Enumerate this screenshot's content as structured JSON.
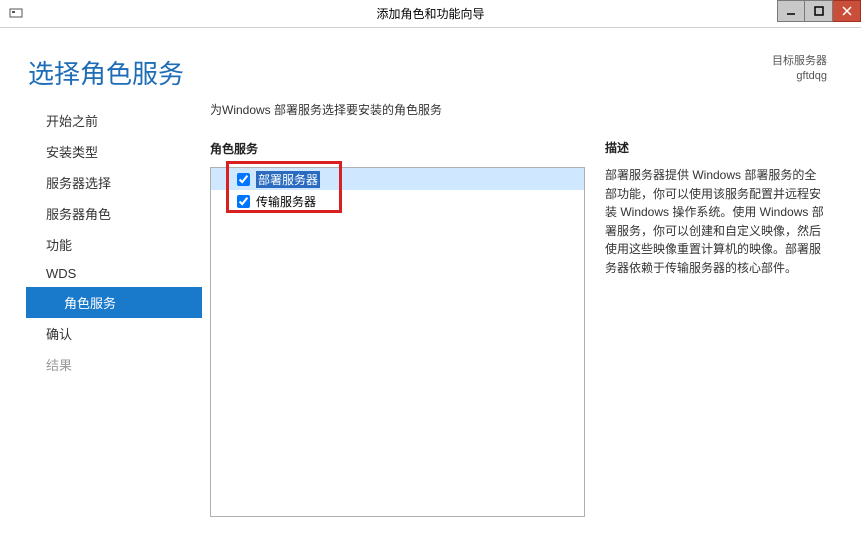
{
  "window": {
    "title": "添加角色和功能向导"
  },
  "header": {
    "page_title": "选择角色服务",
    "target_label": "目标服务器",
    "target_value": "gftdqg"
  },
  "sidebar": {
    "items": [
      {
        "label": "开始之前",
        "state": "normal"
      },
      {
        "label": "安装类型",
        "state": "normal"
      },
      {
        "label": "服务器选择",
        "state": "normal"
      },
      {
        "label": "服务器角色",
        "state": "normal"
      },
      {
        "label": "功能",
        "state": "normal"
      },
      {
        "label": "WDS",
        "state": "normal"
      },
      {
        "label": "角色服务",
        "state": "selected",
        "indent": true
      },
      {
        "label": "确认",
        "state": "normal"
      },
      {
        "label": "结果",
        "state": "disabled"
      }
    ]
  },
  "main": {
    "instruction": "为Windows 部署服务选择要安装的角色服务",
    "list_header": "角色服务",
    "items": [
      {
        "label": "部署服务器",
        "checked": true,
        "selected": true
      },
      {
        "label": "传输服务器",
        "checked": true,
        "selected": false
      }
    ],
    "desc_header": "描述",
    "description": "部署服务器提供 Windows 部署服务的全部功能，你可以使用该服务配置并远程安装 Windows 操作系统。使用 Windows 部署服务，你可以创建和自定义映像，然后使用这些映像重置计算机的映像。部署服务器依赖于传输服务器的核心部件。"
  }
}
